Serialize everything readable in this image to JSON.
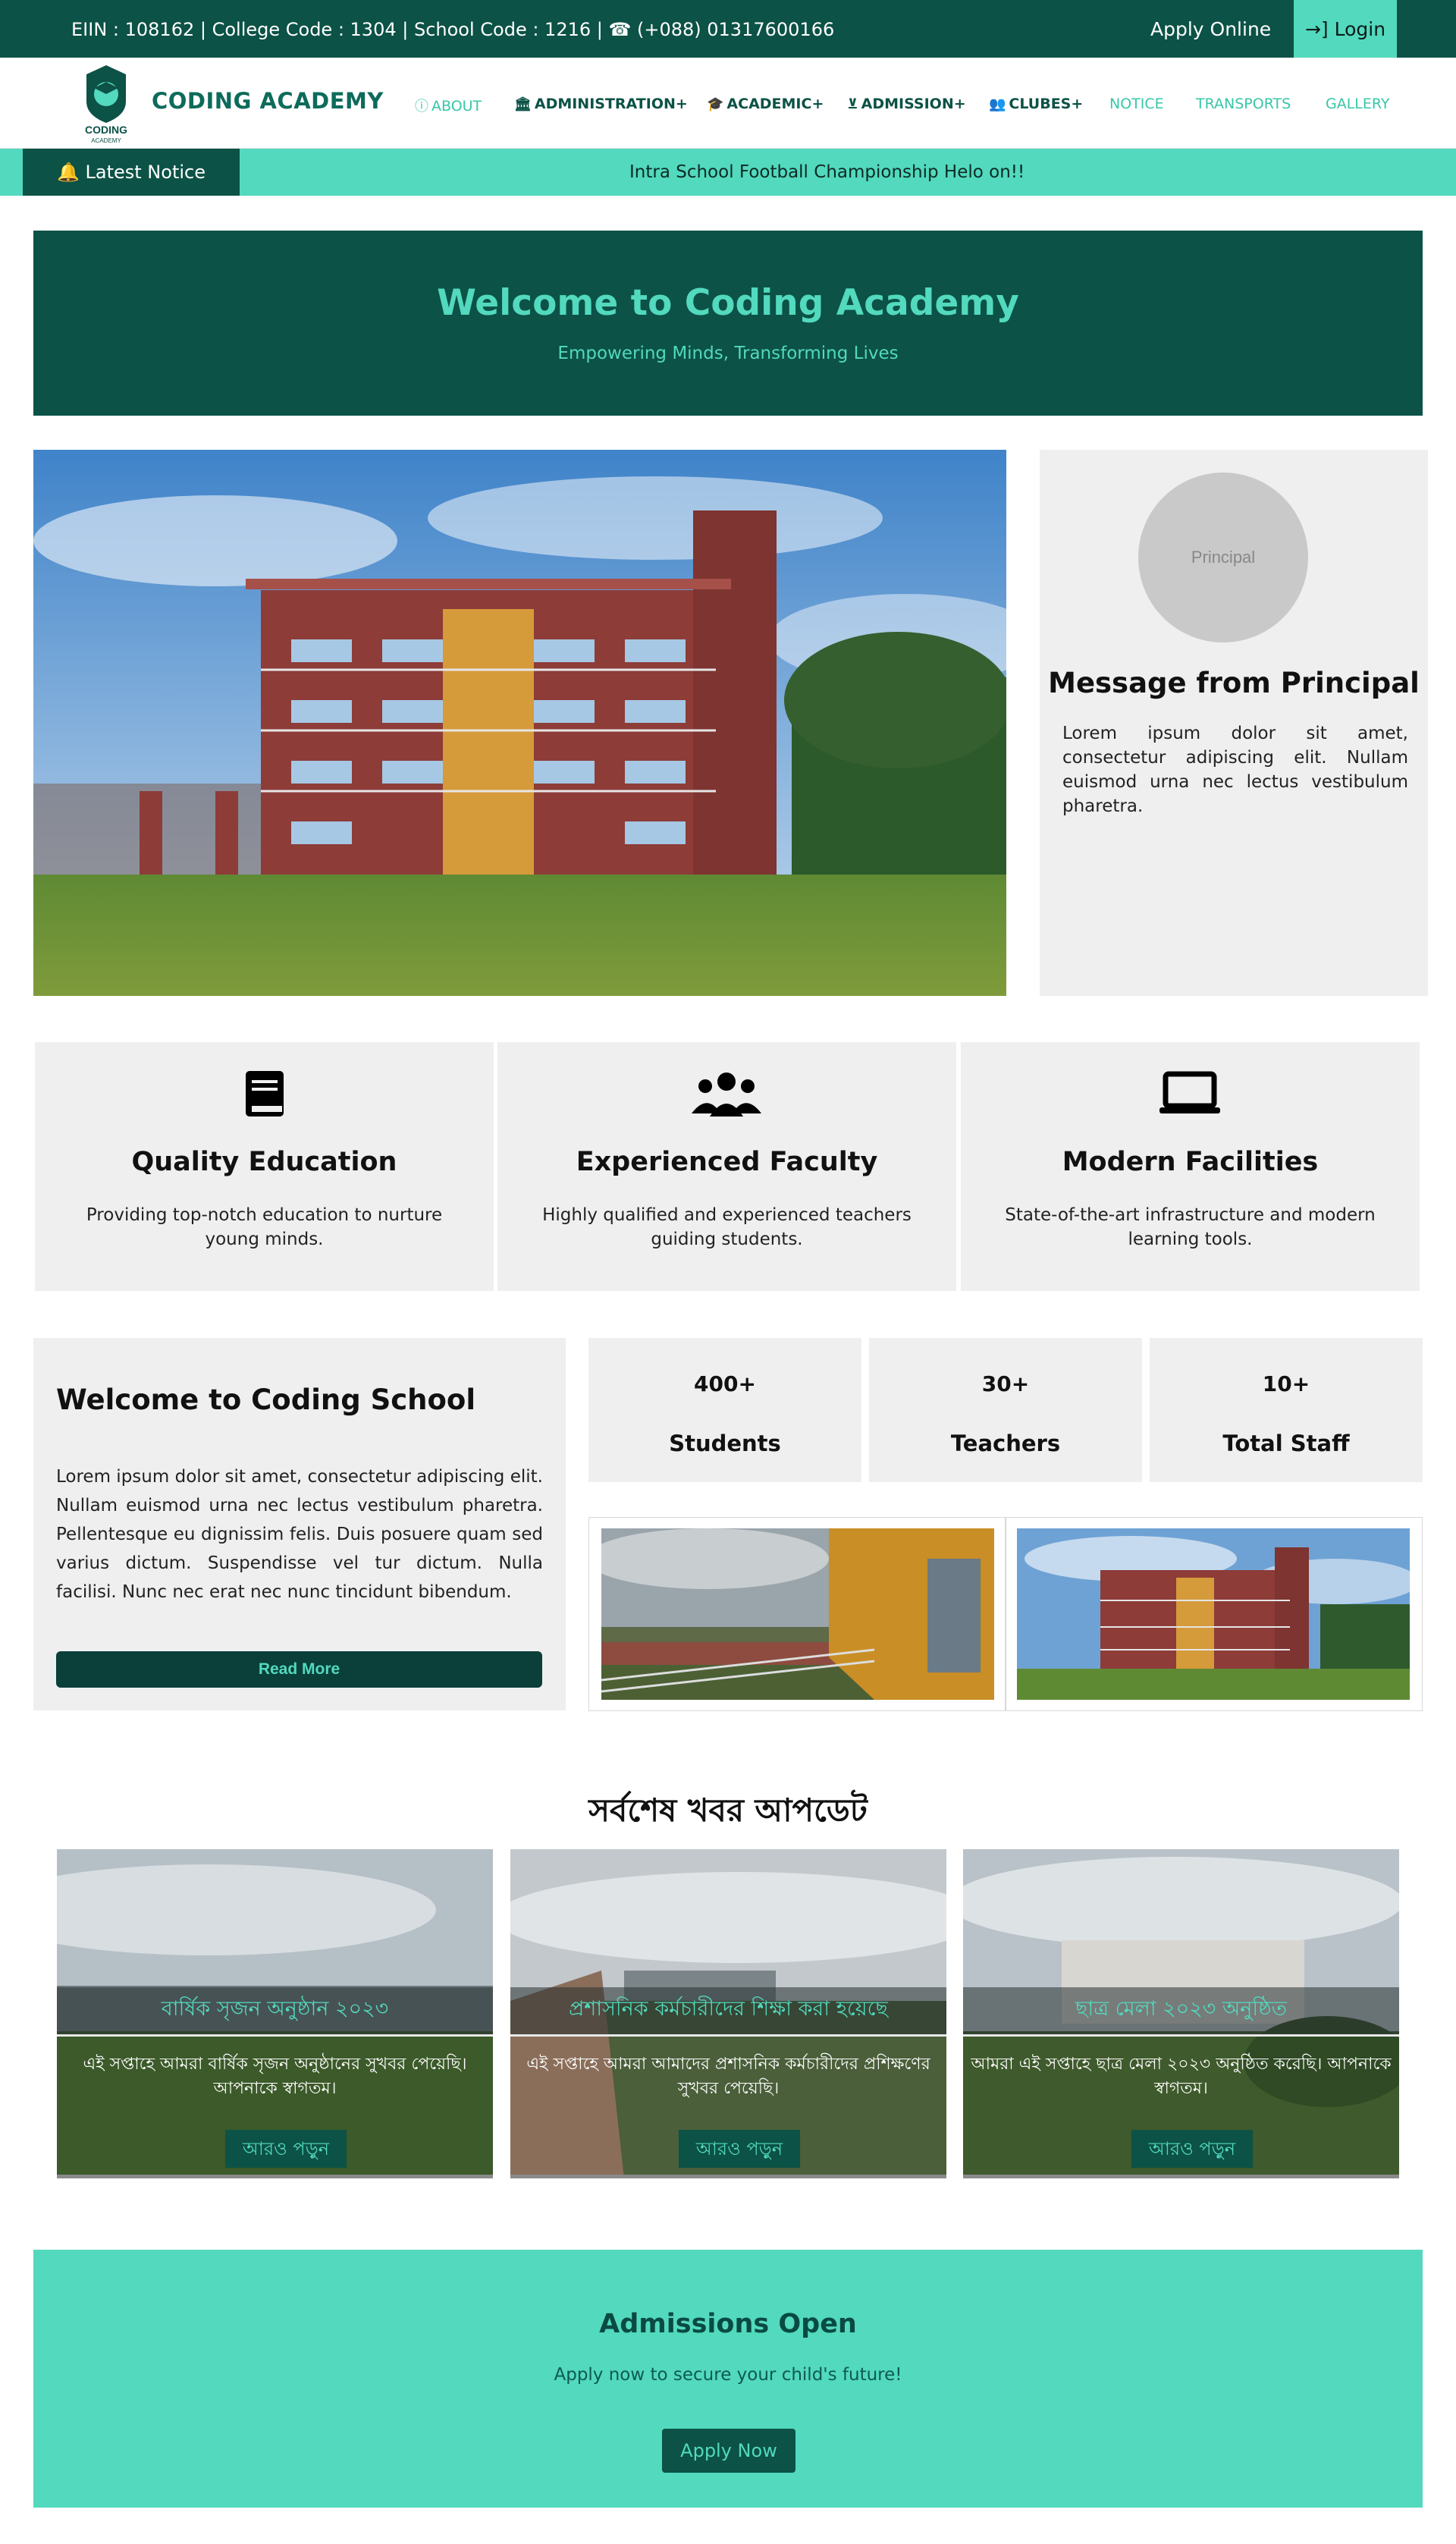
{
  "topbar": {
    "info": "EIIN : 108162 | College Code : 1304 | School Code : 1216 | ☎ (+088) 01317600166",
    "apply_online": "Apply Online",
    "login": "→] Login"
  },
  "brand": {
    "name": "CODING ACADEMY",
    "logo_text": "CODING",
    "logo_sub": "ACADEMY"
  },
  "nav": {
    "about": "ABOUT",
    "administration": "ADMINISTRATION+",
    "academic": "ACADEMIC+",
    "admission": "ADMISSION+",
    "clubes": "CLUBES+",
    "notice": "NOTICE",
    "transports": "TRANSPORTS",
    "gallery": "GALLERY"
  },
  "ticker": {
    "label": "🔔 Latest Notice",
    "message": "Intra School Football Championship Helo on!!"
  },
  "hero": {
    "title": "Welcome to Coding Academy",
    "subtitle": "Empowering Minds, Transforming Lives"
  },
  "principal": {
    "placeholder": "Principal",
    "heading": "Message from Principal",
    "text": "Lorem ipsum dolor sit amet, consectetur adipiscing elit. Nullam euismod urna nec lectus vestibulum pharetra."
  },
  "features": [
    {
      "icon": "book-icon",
      "title": "Quality Education",
      "text": "Providing top-notch education to nurture young minds."
    },
    {
      "icon": "users-icon",
      "title": "Experienced Faculty",
      "text": "Highly qualified and experienced teachers guiding students."
    },
    {
      "icon": "laptop-icon",
      "title": "Modern Facilities",
      "text": "State-of-the-art infrastructure and modern learning tools."
    }
  ],
  "welcome": {
    "title": "Welcome to Coding School",
    "text": "Lorem ipsum dolor sit amet, consectetur adipiscing elit. Nullam euismod urna nec lectus vestibulum pharetra. Pellentesque eu dignissim felis. Duis posuere quam sed varius dictum. Suspendisse vel tur dictum. Nulla facilisi. Nunc nec erat nec nunc tincidunt bibendum.",
    "button": "Read More"
  },
  "stats": [
    {
      "value": "400+",
      "label": "Students"
    },
    {
      "value": "30+",
      "label": "Teachers"
    },
    {
      "value": "10+",
      "label": "Total Staff"
    }
  ],
  "news": {
    "heading": "সর্বশেষ খবর আপডেট",
    "cards": [
      {
        "title": "বার্ষিক সৃজন অনুষ্ঠান ২০২৩",
        "line1": "এই সপ্তাহে আমরা বার্ষিক সৃজন অনুষ্ঠানের সুখবর পেয়েছি।",
        "line2": "আপনাকে স্বাগতম।",
        "button": "আরও পড়ুন"
      },
      {
        "title": "প্রশাসনিক কর্মচারীদের শিক্ষা করা হয়েছে",
        "line1": "এই সপ্তাহে আমরা আমাদের প্রশাসনিক কর্মচারীদের প্রশিক্ষণের",
        "line2": "সুখবর পেয়েছি।",
        "button": "আরও পড়ুন"
      },
      {
        "title": "ছাত্র মেলা ২০২৩ অনুষ্ঠিত",
        "line1": "আমরা এই সপ্তাহে ছাত্র মেলা ২০২৩ অনুষ্ঠিত করেছি। আপনাকে",
        "line2": "স্বাগতম।",
        "button": "আরও পড়ুন"
      }
    ]
  },
  "admissions": {
    "title": "Admissions Open",
    "text": "Apply now to secure your child's future!",
    "button": "Apply Now"
  },
  "colors": {
    "dark_teal": "#0c5246",
    "mint": "#52d9be",
    "panel": "#efefef"
  }
}
